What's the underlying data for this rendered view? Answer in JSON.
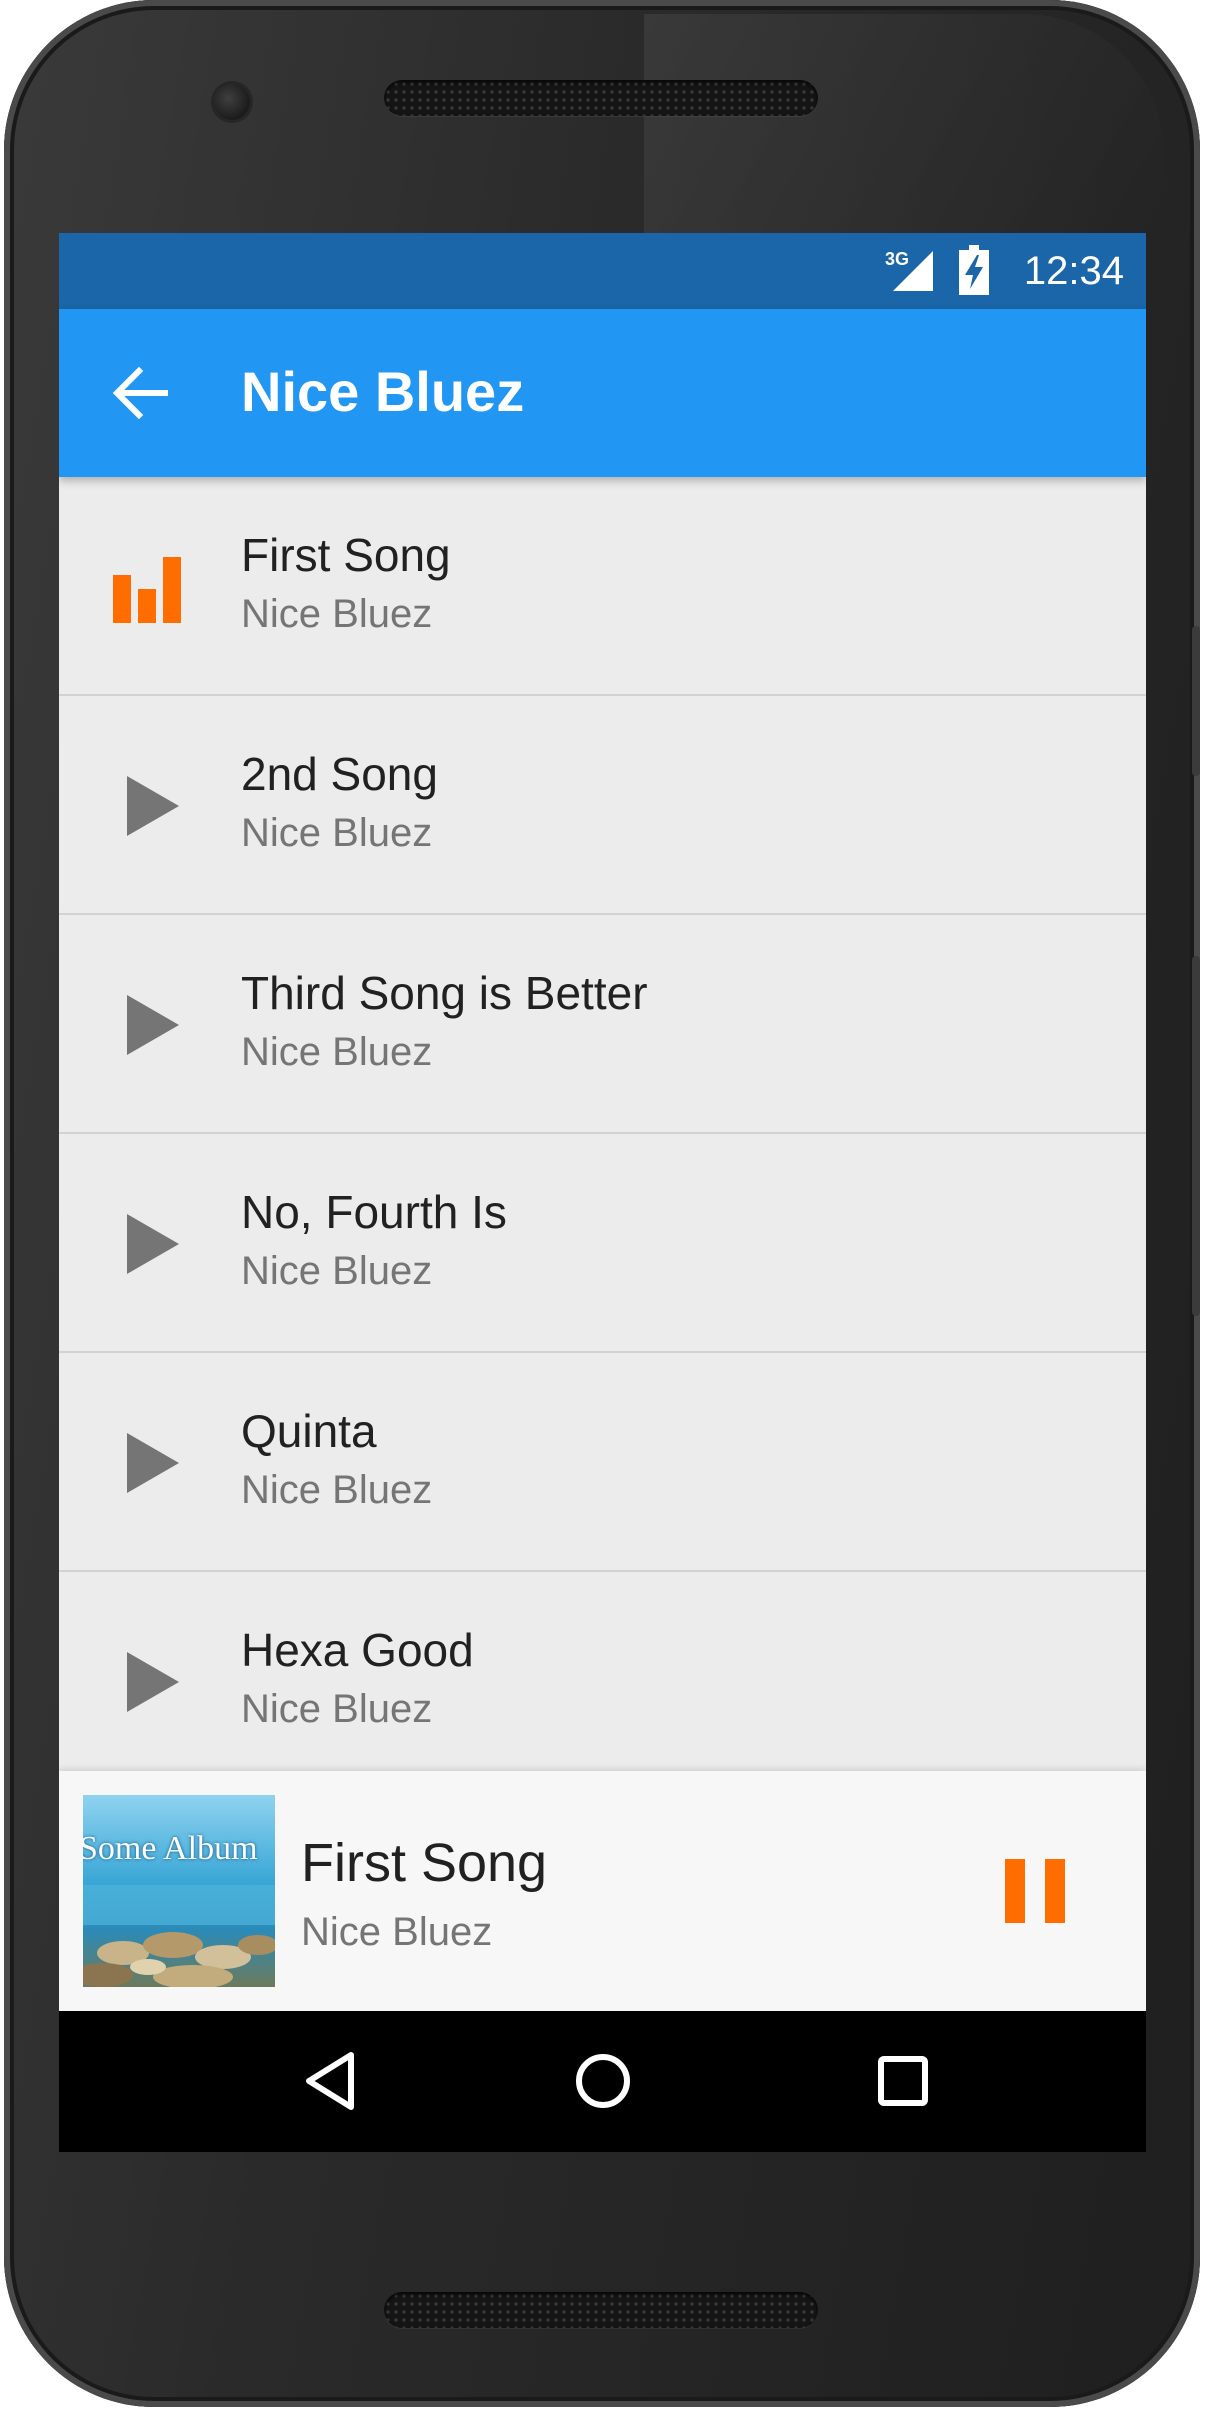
{
  "status_bar": {
    "network": "3G",
    "time": "12:34",
    "icons": [
      "signal-icon",
      "battery-charging-icon"
    ]
  },
  "app_bar": {
    "back_icon": "arrow-back-icon",
    "title": "Nice Bluez",
    "color": "#2196F3"
  },
  "songs": [
    {
      "title": "First Song",
      "artist": "Nice Bluez",
      "state": "playing",
      "icon": "equalizer-icon"
    },
    {
      "title": "2nd Song",
      "artist": "Nice Bluez",
      "state": "idle",
      "icon": "play-icon"
    },
    {
      "title": "Third Song is Better",
      "artist": "Nice Bluez",
      "state": "idle",
      "icon": "play-icon"
    },
    {
      "title": "No, Fourth Is",
      "artist": "Nice Bluez",
      "state": "idle",
      "icon": "play-icon"
    },
    {
      "title": "Quinta",
      "artist": "Nice Bluez",
      "state": "idle",
      "icon": "play-icon"
    },
    {
      "title": "Hexa Good",
      "artist": "Nice Bluez",
      "state": "idle",
      "icon": "play-icon"
    }
  ],
  "now_playing": {
    "album_art_text": "Some Album",
    "title": "First Song",
    "artist": "Nice Bluez",
    "control_icon": "pause-icon"
  },
  "nav_bar": {
    "icons": [
      "back-triangle-icon",
      "home-circle-icon",
      "recents-square-icon"
    ]
  },
  "colors": {
    "accent": "#FF6D00",
    "primary": "#2196F3",
    "status_bar": "#1A66A8",
    "play_icon": "#757575"
  }
}
